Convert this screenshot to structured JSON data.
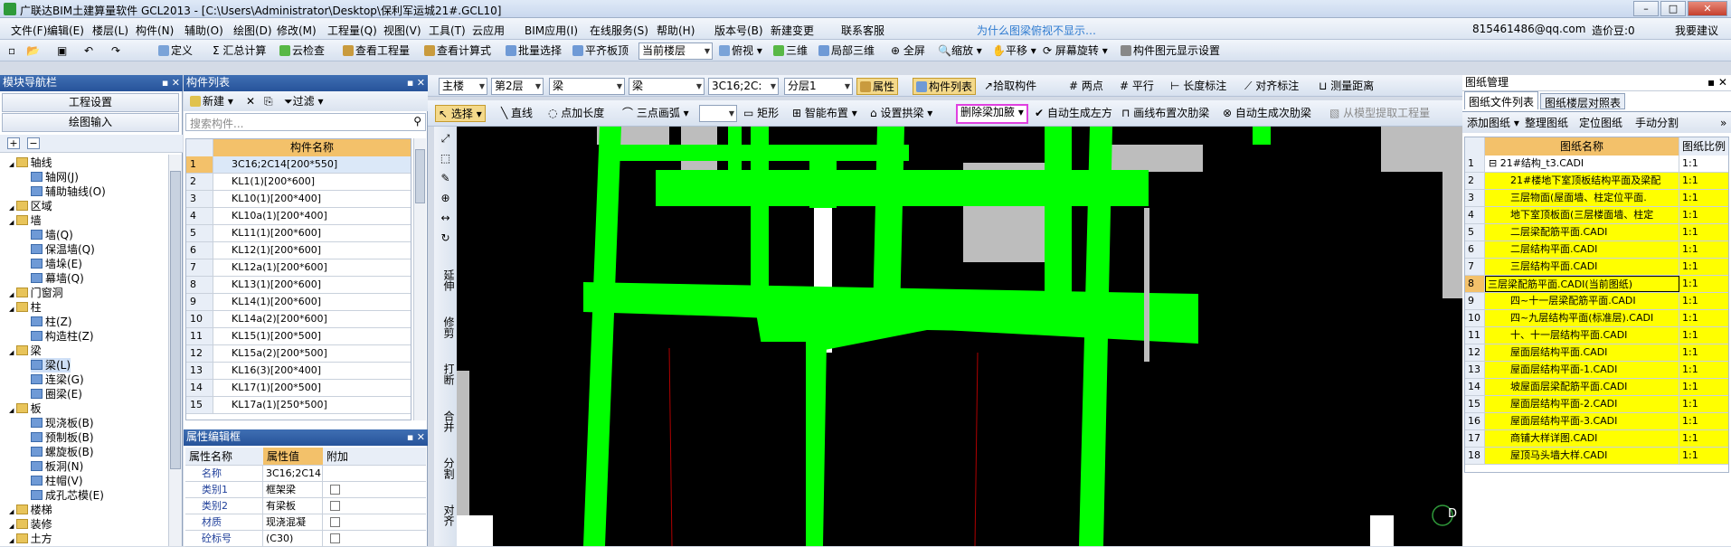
{
  "window": {
    "title": "广联达BIM土建算量软件 GCL2013 - [C:\\Users\\Administrator\\Desktop\\保利军运城21#.GCL10]"
  },
  "menu": [
    "文件(F)",
    "编辑(E)",
    "楼层(L)",
    "构件(N)",
    "辅助(O)",
    "绘图(D)",
    "修改(M)",
    "工程量(Q)",
    "视图(V)",
    "工具(T)",
    "云应用",
    "BIM应用(I)",
    "在线服务(S)",
    "帮助(H)",
    "版本号(B)",
    "新建变更",
    "联系客服"
  ],
  "menu_right": {
    "hint": "为什么图梁俯视不显示…",
    "account": "815461486@qq.com",
    "price_bean": "造价豆:0",
    "suggest": "我要建议"
  },
  "toolbar1": {
    "define": "定义",
    "sum": "汇总计算",
    "cloud_check": "云检查",
    "view_qty": "查看工程量",
    "view_formula": "查看计算式",
    "batch_select": "批量选择",
    "flush_slab": "平齐板顶",
    "floor_combo": "当前楼层",
    "topview": "俯视",
    "three_d": "三维",
    "local_3d": "局部三维",
    "fullscreen": "全屏",
    "zoom": "缩放",
    "pan": "平移",
    "rotate": "屏幕旋转",
    "display_settings": "构件图元显示设置"
  },
  "toolbar2": {
    "combo_main": "主楼",
    "combo_floor": "第2层",
    "combo_type1": "梁",
    "combo_type2": "梁",
    "combo_comp": "3C16;2C:",
    "combo_layer": "分层1",
    "property": "属性",
    "comp_list": "构件列表",
    "pick": "拾取构件",
    "two_point": "两点",
    "parallel": "平行",
    "length_mark": "长度标注",
    "align_mark": "对齐标注",
    "measure": "测量距离"
  },
  "toolbar3": {
    "select": "选择",
    "line": "直线",
    "point_length": "点加长度",
    "three_arc": "三点画弧",
    "rect": "矩形",
    "smart_place": "智能布置",
    "set_arch": "设置拱梁",
    "delete_haunch": "删除梁加腋",
    "gen_column_top": "自动生成左方",
    "line_secondary": "画线布置次肋梁",
    "gen_secondary": "自动生成次肋梁",
    "extract_qty": "从模型提取工程量"
  },
  "nav": {
    "header": "模块导航栏",
    "project_settings": "工程设置",
    "drawing_input": "绘图输入",
    "tree": [
      {
        "label": "轴线",
        "level": 0,
        "kind": "folder"
      },
      {
        "label": "轴网(J)",
        "level": 1,
        "kind": "item"
      },
      {
        "label": "辅助轴线(O)",
        "level": 1,
        "kind": "item"
      },
      {
        "label": "区域",
        "level": 0,
        "kind": "folder"
      },
      {
        "label": "墙",
        "level": 0,
        "kind": "folder"
      },
      {
        "label": "墙(Q)",
        "level": 1,
        "kind": "item"
      },
      {
        "label": "保温墙(Q)",
        "level": 1,
        "kind": "item"
      },
      {
        "label": "墙垛(E)",
        "level": 1,
        "kind": "item"
      },
      {
        "label": "幕墙(Q)",
        "level": 1,
        "kind": "item"
      },
      {
        "label": "门窗洞",
        "level": 0,
        "kind": "folder"
      },
      {
        "label": "柱",
        "level": 0,
        "kind": "folder"
      },
      {
        "label": "柱(Z)",
        "level": 1,
        "kind": "item"
      },
      {
        "label": "构造柱(Z)",
        "level": 1,
        "kind": "item"
      },
      {
        "label": "梁",
        "level": 0,
        "kind": "folder"
      },
      {
        "label": "梁(L)",
        "level": 1,
        "kind": "item",
        "selected": true
      },
      {
        "label": "连梁(G)",
        "level": 1,
        "kind": "item"
      },
      {
        "label": "圈梁(E)",
        "level": 1,
        "kind": "item"
      },
      {
        "label": "板",
        "level": 0,
        "kind": "folder"
      },
      {
        "label": "现浇板(B)",
        "level": 1,
        "kind": "item"
      },
      {
        "label": "预制板(B)",
        "level": 1,
        "kind": "item"
      },
      {
        "label": "螺旋板(B)",
        "level": 1,
        "kind": "item"
      },
      {
        "label": "板洞(N)",
        "level": 1,
        "kind": "item"
      },
      {
        "label": "柱帽(V)",
        "level": 1,
        "kind": "item"
      },
      {
        "label": "成孔芯模(E)",
        "level": 1,
        "kind": "item"
      },
      {
        "label": "楼梯",
        "level": 0,
        "kind": "folder"
      },
      {
        "label": "装修",
        "level": 0,
        "kind": "folder"
      },
      {
        "label": "土方",
        "level": 0,
        "kind": "folder"
      }
    ]
  },
  "complist": {
    "header": "构件列表",
    "new": "新建",
    "filter": "过滤",
    "search_placeholder": "搜索构件...",
    "col_name": "构件名称",
    "rows": [
      [
        "1",
        "3C16;2C14[200*550]"
      ],
      [
        "2",
        "KL1(1)[200*600]"
      ],
      [
        "3",
        "KL10(1)[200*400]"
      ],
      [
        "4",
        "KL10a(1)[200*400]"
      ],
      [
        "5",
        "KL11(1)[200*600]"
      ],
      [
        "6",
        "KL12(1)[200*600]"
      ],
      [
        "7",
        "KL12a(1)[200*600]"
      ],
      [
        "8",
        "KL13(1)[200*600]"
      ],
      [
        "9",
        "KL14(1)[200*600]"
      ],
      [
        "10",
        "KL14a(2)[200*600]"
      ],
      [
        "11",
        "KL15(1)[200*500]"
      ],
      [
        "12",
        "KL15a(2)[200*500]"
      ],
      [
        "13",
        "KL16(3)[200*400]"
      ],
      [
        "14",
        "KL17(1)[200*500]"
      ],
      [
        "15",
        "KL17a(1)[250*500]"
      ]
    ]
  },
  "propedit": {
    "header": "属性编辑框",
    "col_name": "属性名称",
    "col_value": "属性值",
    "col_extra": "附加",
    "rows": [
      [
        "名称",
        "3C16;2C14"
      ],
      [
        "类别1",
        "框架梁"
      ],
      [
        "类别2",
        "有梁板"
      ],
      [
        "材质",
        "现浇混凝"
      ],
      [
        "砼标号",
        "(C30)"
      ]
    ]
  },
  "vtools": [
    "延伸",
    "修剪",
    "打断",
    "合并",
    "分割",
    "对齐"
  ],
  "drawings": {
    "header": "图纸管理",
    "tab1": "图纸文件列表",
    "tab2": "图纸楼层对照表",
    "add": "添加图纸",
    "organize": "整理图纸",
    "locate": "定位图纸",
    "split": "手动分割",
    "col_name": "图纸名称",
    "col_scale": "图纸比例",
    "rows": [
      [
        "1",
        "21#结构_t3.CADI",
        "1:1"
      ],
      [
        "2",
        "21#楼地下室顶板结构平面及梁配",
        "1:1"
      ],
      [
        "3",
        "三层物面(屋面墙、柱定位平面.",
        "1:1"
      ],
      [
        "4",
        "地下室顶板面(三层楼面墙、柱定",
        "1:1"
      ],
      [
        "5",
        "二层梁配筋平面.CADI",
        "1:1"
      ],
      [
        "6",
        "二层结构平面.CADI",
        "1:1"
      ],
      [
        "7",
        "三层结构平面.CADI",
        "1:1"
      ],
      [
        "8",
        "三层梁配筋平面.CADI(当前图纸)",
        "1:1"
      ],
      [
        "9",
        "四~十一层梁配筋平面.CADI",
        "1:1"
      ],
      [
        "10",
        "四~九层结构平面(标准层).CADI",
        "1:1"
      ],
      [
        "11",
        "十、十一层结构平面.CADI",
        "1:1"
      ],
      [
        "12",
        "屋面层结构平面.CADI",
        "1:1"
      ],
      [
        "13",
        "屋面层结构平面-1.CADI",
        "1:1"
      ],
      [
        "14",
        "坡屋面层梁配筋平面.CADI",
        "1:1"
      ],
      [
        "15",
        "屋面层结构平面-2.CADI",
        "1:1"
      ],
      [
        "16",
        "屋面层结构平面-3.CADI",
        "1:1"
      ],
      [
        "17",
        "商铺大样详图.CADI",
        "1:1"
      ],
      [
        "18",
        "屋顶马头墙大样.CADI",
        "1:1"
      ]
    ]
  },
  "canvas": {
    "corner_label": "D"
  },
  "colors": {
    "beam": "#00ff00",
    "canvas_bg": "#000000",
    "highlight": "#ffff00",
    "sel_border": "#e040e0"
  }
}
